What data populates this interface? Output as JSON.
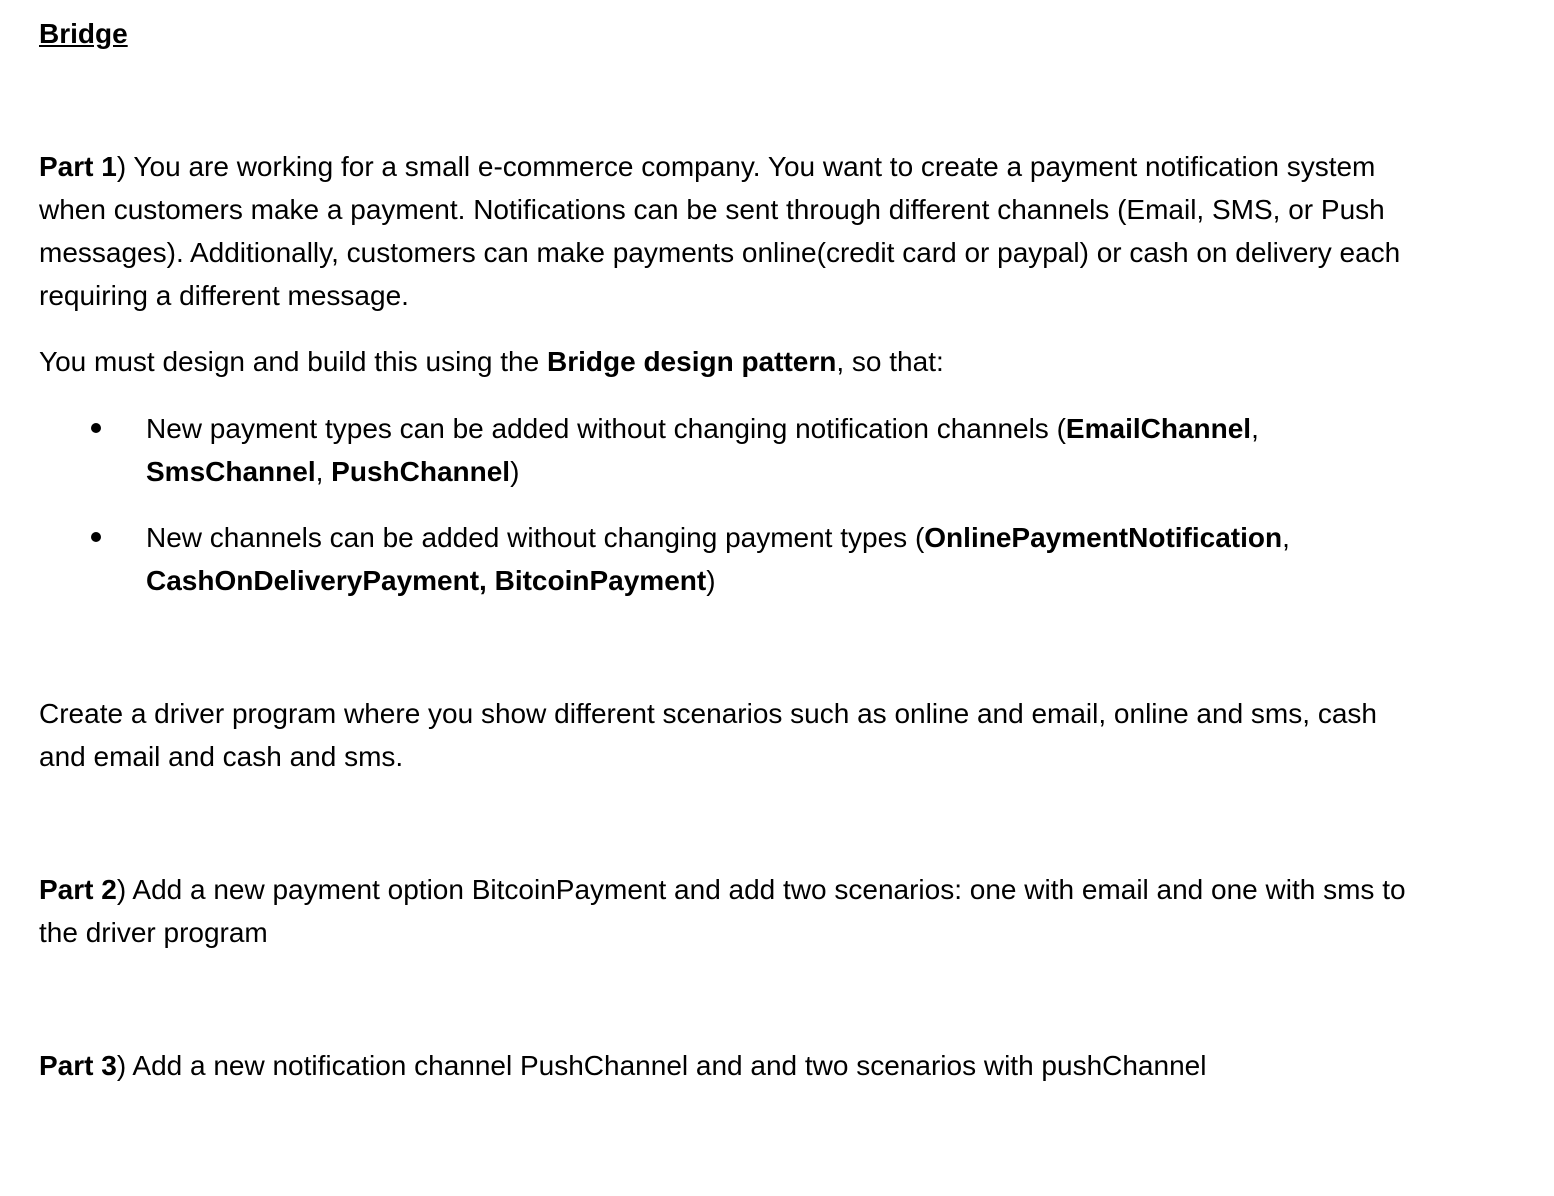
{
  "title": "Bridge",
  "part1": {
    "label": "Part 1",
    "close_paren": ")",
    "text": " You are working for a small e-commerce company. You want to create a payment notification system when customers make a payment. Notifications can be sent through different channels (Email, SMS, or Push messages). Additionally, customers can make payments online(credit card or paypal) or cash on delivery each requiring a different message."
  },
  "design": {
    "prefix": "You must design and build this using the ",
    "pattern": "Bridge design pattern",
    "suffix": ", so that:"
  },
  "bullets": [
    {
      "text": "New payment types can be added without changing notification channels (",
      "bold1": "EmailChannel",
      "sep1": ", ",
      "bold2": "SmsChannel",
      "sep2": ", ",
      "bold3": "PushChannel",
      "end": ")"
    },
    {
      "text": "New channels can be added without changing payment types (",
      "bold1": "OnlinePaymentNotification",
      "sep1": ", ",
      "bold2": "CashOnDeliveryPayment, BitcoinPayment",
      "sep2": "",
      "bold3": "",
      "end": ")"
    }
  ],
  "driver": "Create a driver program where you show different scenarios such as online and email, online and sms, cash and email and cash and sms.",
  "part2": {
    "label": "Part 2",
    "close_paren": ")",
    "text": " Add a new payment option BitcoinPayment and add two scenarios: one with email and one with sms to the driver program"
  },
  "part3": {
    "label": "Part 3",
    "close_paren": ")",
    "text": " Add a new notification channel PushChannel and and two scenarios with pushChannel"
  }
}
